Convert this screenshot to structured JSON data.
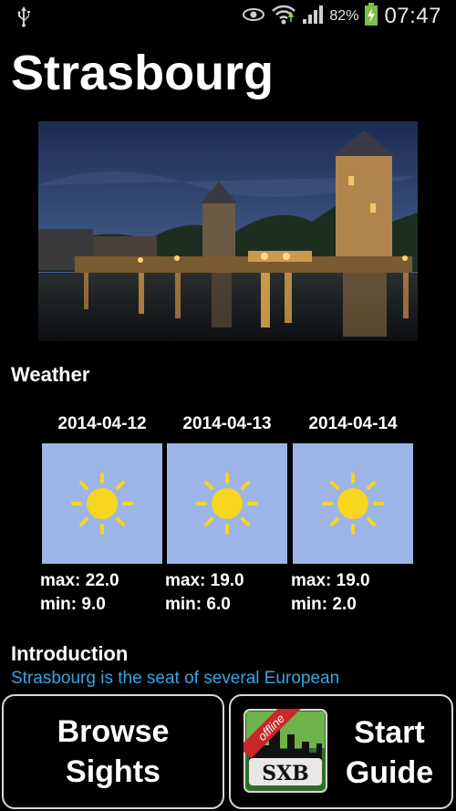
{
  "status_bar": {
    "battery_percent": "82%",
    "time": "07:47",
    "icons": [
      "usb-icon",
      "eye-icon",
      "wifi-icon",
      "signal-icon",
      "battery-charging-icon"
    ]
  },
  "page": {
    "title": "Strasbourg"
  },
  "weather": {
    "heading": "Weather",
    "forecasts": [
      {
        "date": "2014-04-12",
        "icon": "sun-icon",
        "max": "max: 22.0",
        "min": "min: 9.0"
      },
      {
        "date": "2014-04-13",
        "icon": "sun-icon",
        "max": "max: 19.0",
        "min": "min: 6.0"
      },
      {
        "date": "2014-04-14",
        "icon": "sun-icon",
        "max": "max: 19.0",
        "min": "min: 2.0"
      }
    ]
  },
  "introduction": {
    "heading": "Introduction",
    "text": "Strasbourg is the seat of several European"
  },
  "buttons": {
    "browse_line1": "Browse",
    "browse_line2": "Sights",
    "start_line1": "Start",
    "start_line2": "Guide",
    "app_icon_badge": "offline",
    "app_icon_label": "SXB"
  },
  "colors": {
    "background": "#000000",
    "weather_tile": "#9db5e6",
    "sun": "#f6d61e",
    "intro_text": "#38a6e0"
  }
}
